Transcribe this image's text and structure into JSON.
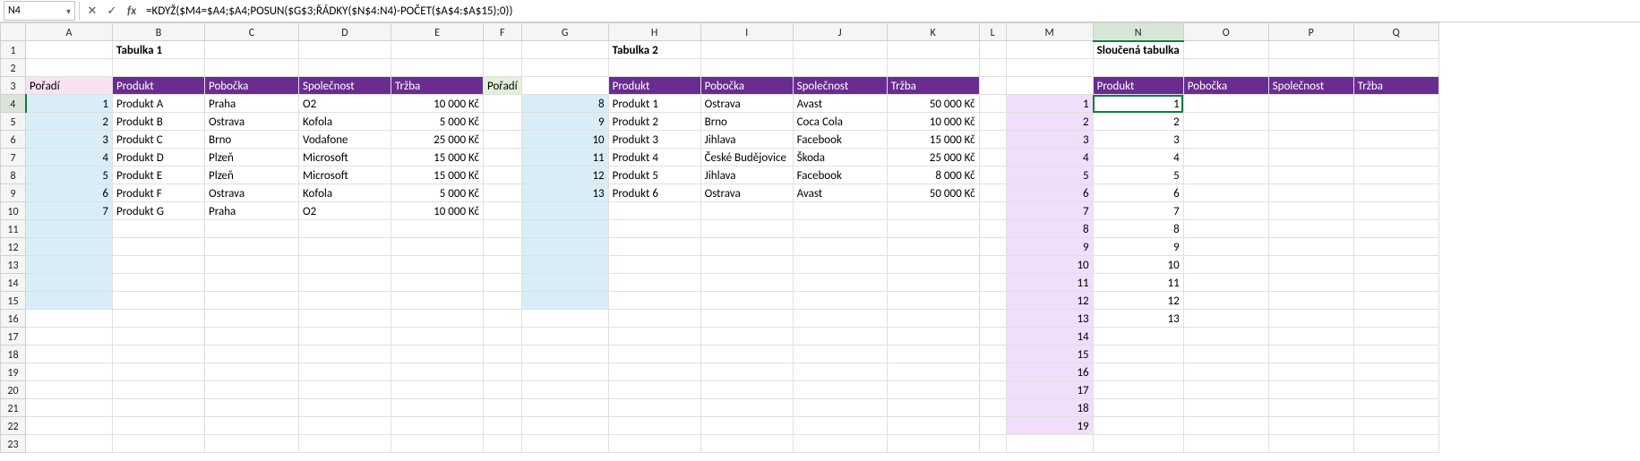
{
  "nameBox": "N4",
  "formula": "=KDYŽ($M4=$A4;$A4;POSUN($G$3;ŘÁDKY($N$4:N4)-POČET($A$4:$A$15);0))",
  "columns": [
    "A",
    "B",
    "C",
    "D",
    "E",
    "F",
    "G",
    "H",
    "I",
    "J",
    "K",
    "L",
    "M",
    "N",
    "O",
    "P",
    "Q"
  ],
  "selectedCell": {
    "col": "N",
    "row": 4
  },
  "titles": {
    "tabulka1": "Tabulka 1",
    "tabulka2": "Tabulka 2",
    "merged": "Sloučená tabulka"
  },
  "labels": {
    "poradi": "Pořadí",
    "produkt": "Produkt",
    "pobocka": "Pobočka",
    "spolecnost": "Společnost",
    "trzba": "Tržba"
  },
  "table1": [
    {
      "order": 1,
      "produkt": "Produkt A",
      "pobocka": "Praha",
      "spolecnost": "O2",
      "trzba": "10 000 Kč"
    },
    {
      "order": 2,
      "produkt": "Produkt B",
      "pobocka": "Ostrava",
      "spolecnost": "Kofola",
      "trzba": "5 000 Kč"
    },
    {
      "order": 3,
      "produkt": "Produkt C",
      "pobocka": "Brno",
      "spolecnost": "Vodafone",
      "trzba": "25 000 Kč"
    },
    {
      "order": 4,
      "produkt": "Produkt D",
      "pobocka": "Plzeň",
      "spolecnost": "Microsoft",
      "trzba": "15 000 Kč"
    },
    {
      "order": 5,
      "produkt": "Produkt E",
      "pobocka": "Plzeň",
      "spolecnost": "Microsoft",
      "trzba": "15 000 Kč"
    },
    {
      "order": 6,
      "produkt": "Produkt F",
      "pobocka": "Ostrava",
      "spolecnost": "Kofola",
      "trzba": "5 000 Kč"
    },
    {
      "order": 7,
      "produkt": "Produkt G",
      "pobocka": "Praha",
      "spolecnost": "O2",
      "trzba": "10 000 Kč"
    }
  ],
  "table2": [
    {
      "order": 8,
      "produkt": "Produkt 1",
      "pobocka": "Ostrava",
      "spolecnost": "Avast",
      "trzba": "50 000 Kč"
    },
    {
      "order": 9,
      "produkt": "Produkt 2",
      "pobocka": "Brno",
      "spolecnost": "Coca Cola",
      "trzba": "10 000 Kč"
    },
    {
      "order": 10,
      "produkt": "Produkt 3",
      "pobocka": "Jihlava",
      "spolecnost": "Facebook",
      "trzba": "15 000 Kč"
    },
    {
      "order": 11,
      "produkt": "Produkt 4",
      "pobocka": "České Budějovice",
      "spolecnost": "Škoda",
      "trzba": "25 000 Kč"
    },
    {
      "order": 12,
      "produkt": "Produkt 5",
      "pobocka": "Jihlava",
      "spolecnost": "Facebook",
      "trzba": "8 000 Kč"
    },
    {
      "order": 13,
      "produkt": "Produkt 6",
      "pobocka": "Ostrava",
      "spolecnost": "Avast",
      "trzba": "50 000 Kč"
    }
  ],
  "mergedM": [
    1,
    2,
    3,
    4,
    5,
    6,
    7,
    8,
    9,
    10,
    11,
    12,
    13,
    14,
    15,
    16,
    17,
    18,
    19
  ],
  "mergedN": [
    1,
    2,
    3,
    4,
    5,
    6,
    7,
    8,
    9,
    10,
    11,
    12,
    13
  ],
  "colWidths": {
    "rowHead": 28,
    "A": 97,
    "B": 103,
    "C": 105,
    "D": 103,
    "E": 103,
    "F": 30,
    "G": 97,
    "H": 103,
    "I": 103,
    "J": 105,
    "K": 103,
    "L": 30,
    "M": 97,
    "N": 95,
    "O": 95,
    "P": 95,
    "Q": 95
  },
  "totalRows": 23
}
